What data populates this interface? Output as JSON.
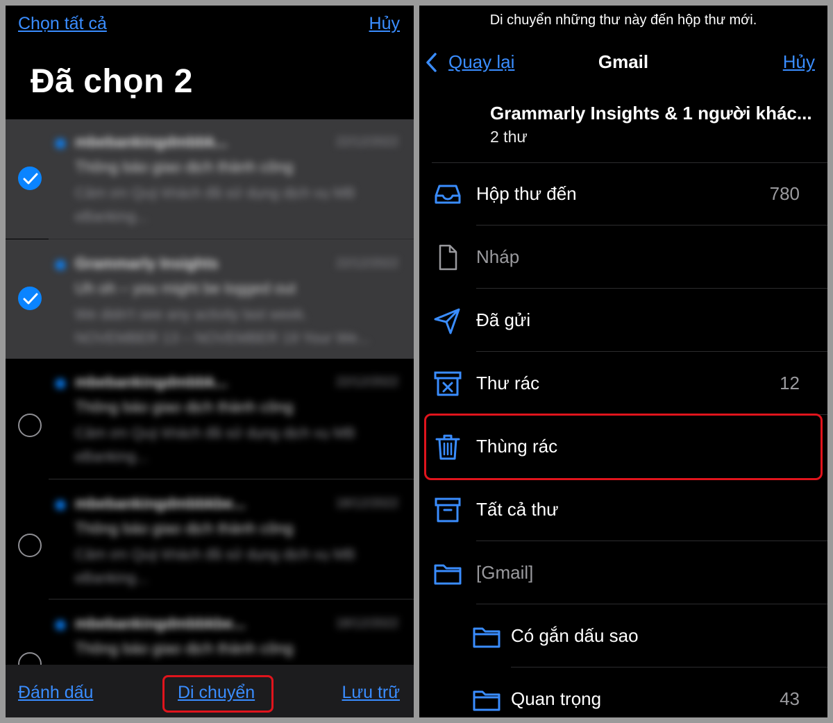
{
  "left": {
    "select_all": "Chọn tất cả",
    "cancel": "Hủy",
    "title": "Đã chọn 2",
    "emails": [
      {
        "sender": "mbebankingdmbbk...",
        "date": "22/12/2022",
        "subject": "Thông báo giao dịch thành công",
        "preview": "Cảm ơn Quý khách đã sử dụng dịch vụ MB eBanking..."
      },
      {
        "sender": "Grammarly Insights",
        "date": "22/12/2022",
        "subject": "Uh oh – you might be logged out",
        "preview": "We didn't see any activity last week. NOVEMBER 13 – NOVEMBER 19 Your We..."
      },
      {
        "sender": "mbebankingdmbbk...",
        "date": "22/12/2022",
        "subject": "Thông báo giao dịch thành công",
        "preview": "Cảm ơn Quý khách đã sử dụng dịch vụ MB eBanking..."
      },
      {
        "sender": "mbebankingdmbbkbe...",
        "date": "18/12/2022",
        "subject": "Thông báo giao dịch thành công",
        "preview": "Cảm ơn Quý khách đã sử dụng dịch vụ MB eBanking..."
      },
      {
        "sender": "mbebankingdmbbkbe...",
        "date": "18/12/2022",
        "subject": "Thông báo giao dịch thành công",
        "preview": ""
      }
    ],
    "toolbar": {
      "mark": "Đánh dấu",
      "move": "Di chuyển",
      "archive": "Lưu trữ"
    }
  },
  "right": {
    "message": "Di chuyển những thư này đến hộp thư mới.",
    "back": "Quay lại",
    "title": "Gmail",
    "cancel": "Hủy",
    "summary_title": "Grammarly Insights & 1 người khác...",
    "summary_sub": "2 thư",
    "folders": [
      {
        "label": "Hộp thư đến",
        "count": "780",
        "icon": "inbox-icon"
      },
      {
        "label": "Nháp",
        "count": "",
        "icon": "draft-icon"
      },
      {
        "label": "Đã gửi",
        "count": "",
        "icon": "sent-icon"
      },
      {
        "label": "Thư rác",
        "count": "12",
        "icon": "junk-icon"
      },
      {
        "label": "Thùng rác",
        "count": "",
        "icon": "trash-icon"
      },
      {
        "label": "Tất cả thư",
        "count": "",
        "icon": "archive-icon"
      },
      {
        "label": "[Gmail]",
        "count": "",
        "icon": "folder-icon"
      },
      {
        "label": "Có gắn dấu sao",
        "count": "",
        "icon": "folder-icon"
      },
      {
        "label": "Quan trọng",
        "count": "43",
        "icon": "folder-icon"
      }
    ]
  },
  "colors": {
    "accent": "#0a84ff",
    "link": "#3a8dff",
    "highlight": "#e0141c",
    "background": "#000000",
    "selected_row": "#3a3a3c"
  }
}
